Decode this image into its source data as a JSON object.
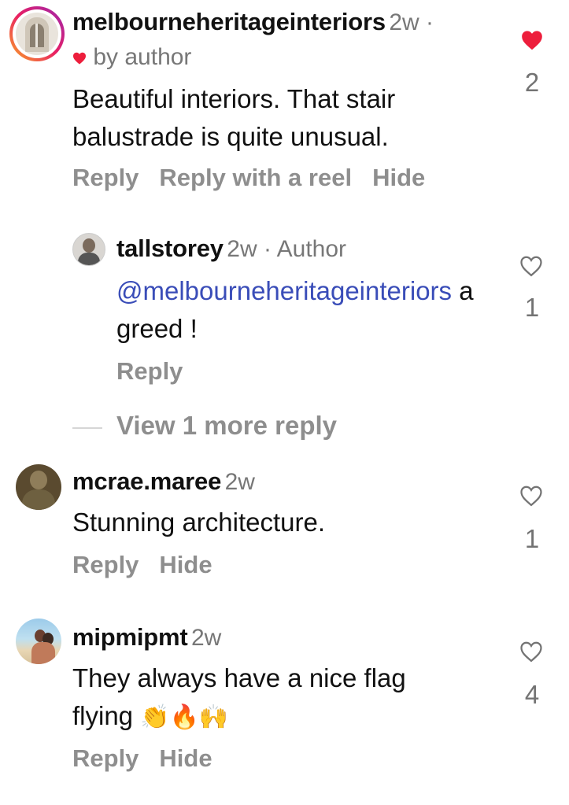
{
  "comments": [
    {
      "username": "melbourneheritageinteriors",
      "time": "2w ·",
      "liked_label": "by author",
      "text": "Beautiful interiors. That stair balustrade is quite unusual.",
      "actions": [
        "Reply",
        "Reply with a reel",
        "Hide"
      ],
      "likes": "2",
      "liked": true
    },
    {
      "username": "tallstorey",
      "time": "2w · Author",
      "mention": "@melbourneheritageinteriors",
      "text": " agreed !",
      "actions": [
        "Reply"
      ],
      "likes": "1",
      "liked": false
    },
    {
      "username": "mcrae.maree",
      "time": "2w",
      "text": "Stunning architecture.",
      "actions": [
        "Reply",
        "Hide"
      ],
      "likes": "1",
      "liked": false
    },
    {
      "username": "mipmipmt",
      "time": "2w",
      "text": "They always have a nice flag flying",
      "emojis": "👏🔥🙌",
      "actions": [
        "Reply",
        "Hide"
      ],
      "likes": "4",
      "liked": false
    }
  ],
  "view_more_replies": "View 1 more reply",
  "colors": {
    "liked_heart": "#ed1e3c",
    "mention": "#3a4db8",
    "muted": "#8e8e8e"
  }
}
